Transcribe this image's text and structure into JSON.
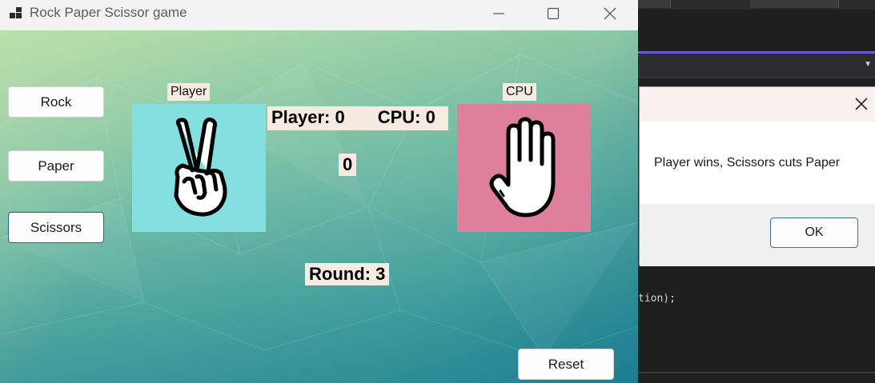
{
  "window": {
    "title": "Rock Paper Scissor game",
    "minimize_icon": "minimize-icon",
    "maximize_icon": "maximize-icon",
    "close_icon": "close-icon"
  },
  "choices": {
    "rock": "Rock",
    "paper": "Paper",
    "scissors": "Scissors"
  },
  "player": {
    "label": "Player",
    "hand": "scissors-hand-icon",
    "bg_color": "#83dfe0"
  },
  "cpu": {
    "label": "CPU",
    "hand": "paper-hand-icon",
    "bg_color": "#de809c"
  },
  "score": {
    "player_text": "Player: 0",
    "cpu_text": "CPU: 0",
    "center_value": "0",
    "round_text": "Round: 3"
  },
  "reset_label": "Reset",
  "dialog": {
    "message": "Player wins, Scissors cuts Paper",
    "ok_label": "OK"
  },
  "ide": {
    "code_fragment": "tion);"
  }
}
